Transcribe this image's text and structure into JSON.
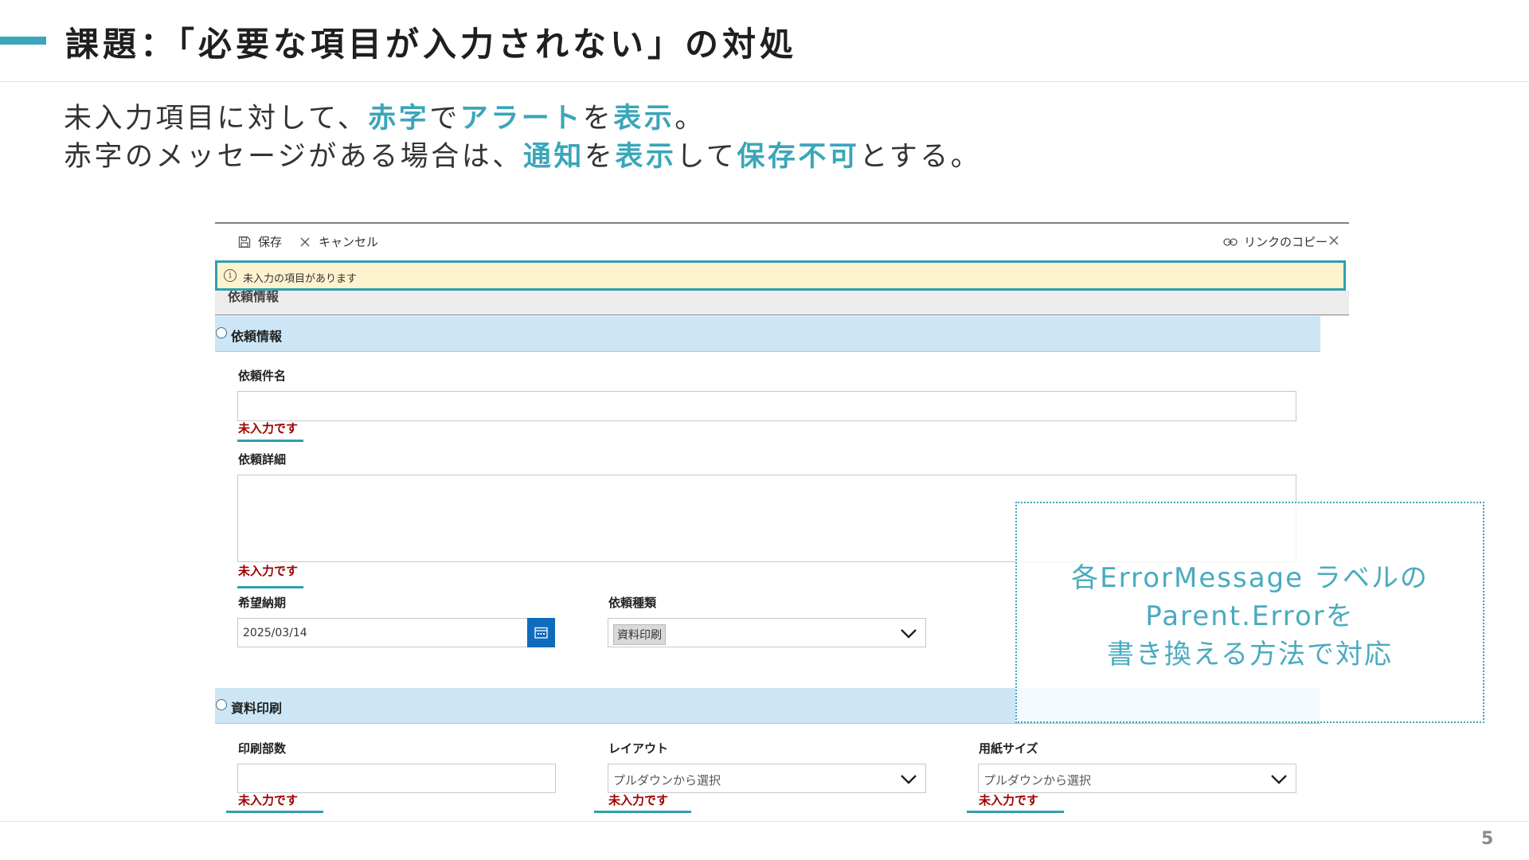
{
  "slide": {
    "title": "課題：「必要な項目が入力されない」の対処",
    "lead1": [
      {
        "text": "未入力項目に対して、",
        "hl": false
      },
      {
        "text": "赤字",
        "hl": true
      },
      {
        "text": "で",
        "hl": false
      },
      {
        "text": "アラート",
        "hl": true
      },
      {
        "text": "を",
        "hl": false
      },
      {
        "text": "表示",
        "hl": true
      },
      {
        "text": "。",
        "hl": false
      }
    ],
    "lead2": [
      {
        "text": "赤字のメッセージがある場合は、",
        "hl": false
      },
      {
        "text": "通知",
        "hl": true
      },
      {
        "text": "を",
        "hl": false
      },
      {
        "text": "表示",
        "hl": true
      },
      {
        "text": "して",
        "hl": false
      },
      {
        "text": "保存不可",
        "hl": true
      },
      {
        "text": "とする。",
        "hl": false
      }
    ],
    "page_number": "5",
    "accent_color": "#3aa6b9"
  },
  "form": {
    "toolbar": {
      "save_label": "保存",
      "cancel_label": "キャンセル",
      "copy_link_label": "リンクのコピー",
      "save_icon": "save-icon",
      "cancel_icon": "close-icon",
      "link_icon": "link-icon",
      "close_icon": "close-icon"
    },
    "alert": {
      "icon": "info-icon",
      "message": "未入力の項目があります"
    },
    "section_request": {
      "title": "依頼情報"
    },
    "request_name": {
      "label": "依頼件名",
      "value": "",
      "error": "未入力です"
    },
    "request_detail": {
      "label": "依頼詳細",
      "value": "",
      "error": "未入力です"
    },
    "due_date": {
      "label": "希望納期",
      "value": "2025/03/14",
      "icon": "calendar-icon"
    },
    "request_type": {
      "label": "依頼種類",
      "value": "資料印刷"
    },
    "section_print": {
      "title": "資料印刷"
    },
    "copies": {
      "label": "印刷部数",
      "value": "",
      "error": "未入力です"
    },
    "layout": {
      "label": "レイアウト",
      "placeholder": "プルダウンから選択",
      "error": "未入力です"
    },
    "paper_size": {
      "label": "用紙サイズ",
      "placeholder": "プルダウンから選択",
      "error": "未入力です"
    }
  },
  "callout": {
    "line1": "各ErrorMessage ラベルの",
    "line2": "Parent.Errorを",
    "line3": "書き換える方法で対応"
  }
}
